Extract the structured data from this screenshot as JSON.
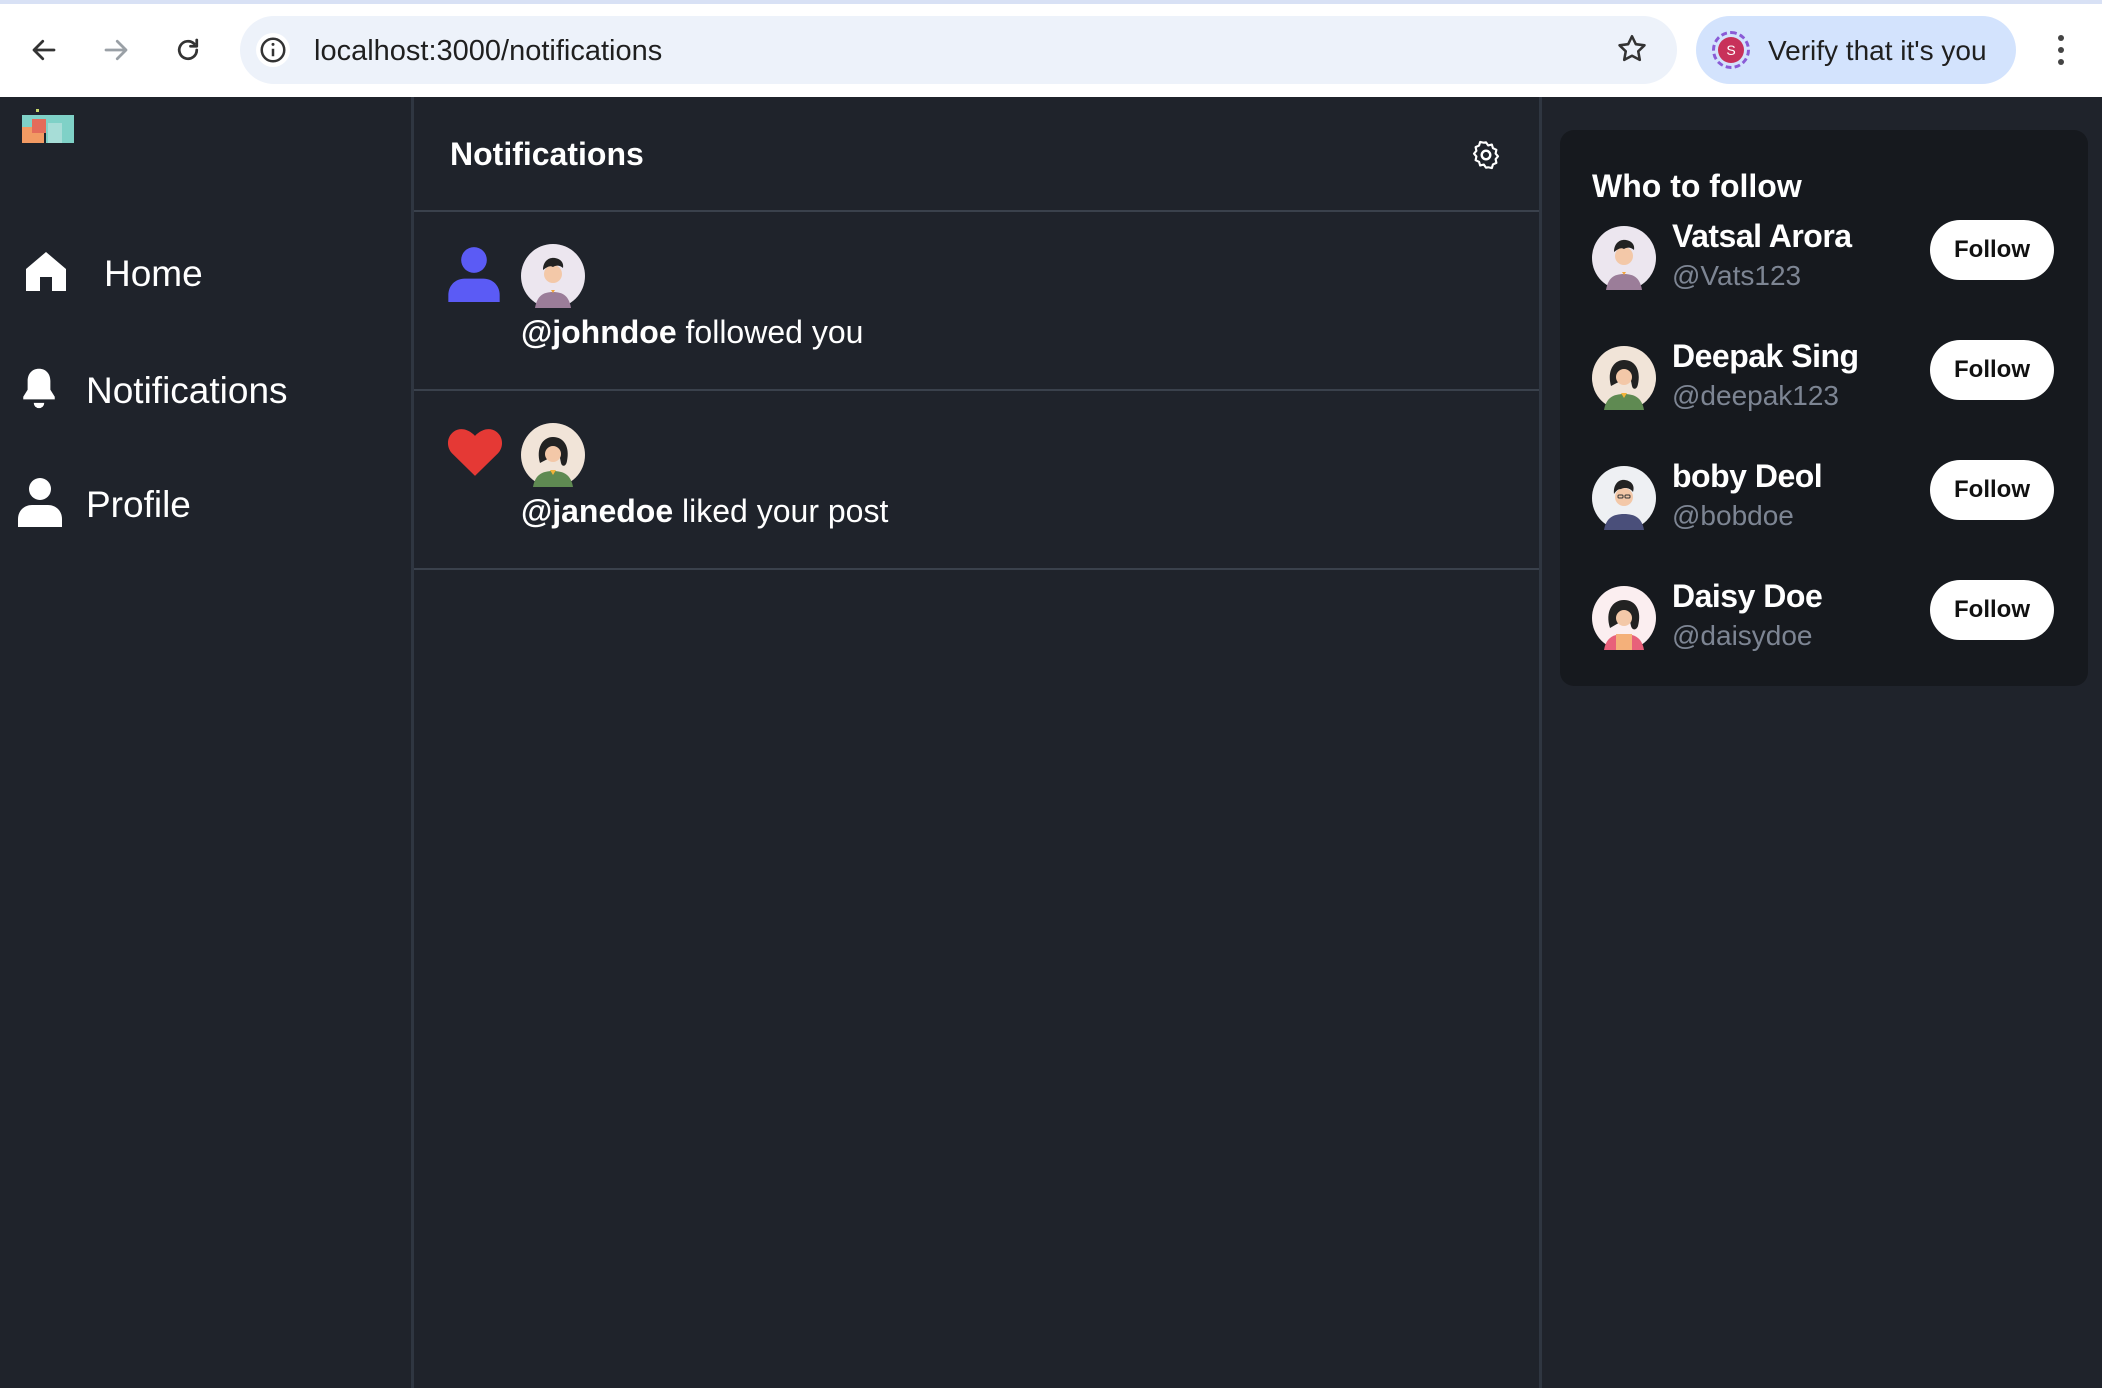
{
  "browser": {
    "url": "localhost:3000/notifications",
    "verify_label": "Verify that it's you",
    "profile_initial": "S"
  },
  "sidebar": {
    "items": [
      {
        "label": "Home",
        "icon": "home-icon"
      },
      {
        "label": "Notifications",
        "icon": "bell-icon"
      },
      {
        "label": "Profile",
        "icon": "user-icon"
      }
    ]
  },
  "main": {
    "title": "Notifications",
    "notifications": [
      {
        "type": "follow",
        "icon": "user-icon",
        "icon_color": "#5b5bf5",
        "handle": "@johndoe",
        "action": " followed you"
      },
      {
        "type": "like",
        "icon": "heart-icon",
        "icon_color": "#e53935",
        "handle": "@janedoe",
        "action": " liked your post"
      }
    ]
  },
  "who_to_follow": {
    "title": "Who to follow",
    "follow_label": "Follow",
    "users": [
      {
        "name": "Vatsal Arora",
        "handle": "@Vats123"
      },
      {
        "name": "Deepak Sing",
        "handle": "@deepak123"
      },
      {
        "name": "boby Deol",
        "handle": "@bobdoe"
      },
      {
        "name": "Daisy Doe",
        "handle": "@daisydoe"
      }
    ]
  },
  "colors": {
    "background": "#1f232b",
    "card": "#16191e",
    "divider": "#3a414c",
    "muted_text": "#7d8593",
    "follow_icon": "#5b5bf5",
    "like_icon": "#e53935"
  }
}
